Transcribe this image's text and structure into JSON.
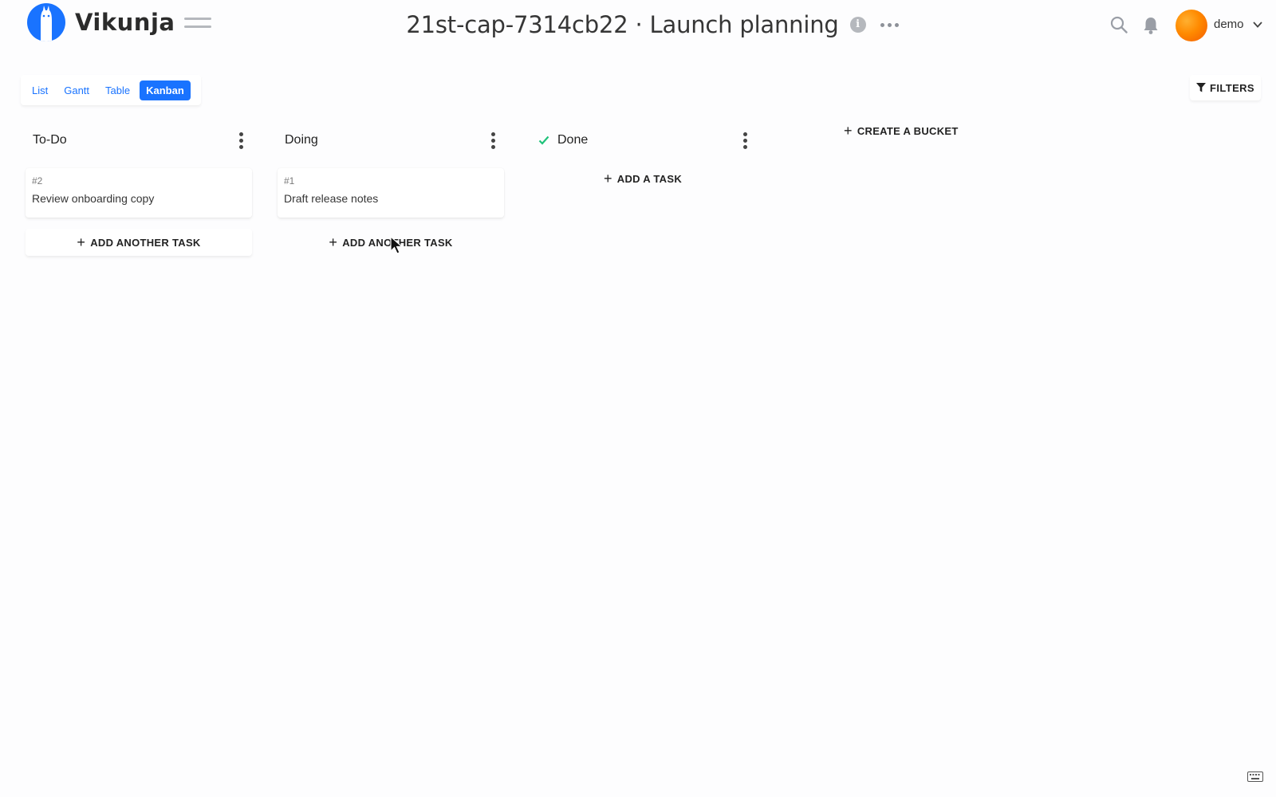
{
  "app": {
    "name": "Vikunja",
    "project_title": "21st-cap-7314cb22 · Launch planning",
    "accent_color": "#1973ff",
    "icons": [
      "vikunja-logo-icon",
      "menu-icon",
      "info-icon",
      "more-icon",
      "search-icon",
      "bell-icon",
      "chevron-down-icon",
      "filter-icon",
      "kebab-icon",
      "check-icon",
      "keyboard-icon"
    ]
  },
  "user": {
    "name": "demo"
  },
  "views": {
    "tabs": [
      {
        "label": "List"
      },
      {
        "label": "Gantt"
      },
      {
        "label": "Table"
      },
      {
        "label": "Kanban",
        "active": true
      }
    ],
    "filters_label": "FILTERS"
  },
  "buckets": [
    {
      "title": "To-Do",
      "cards": [
        {
          "id": "#2",
          "title": "Review onboarding copy"
        }
      ],
      "add_label": "ADD ANOTHER TASK"
    },
    {
      "title": "Doing",
      "cards": [
        {
          "id": "#1",
          "title": "Draft release notes"
        }
      ],
      "add_label": "ADD ANOTHER TASK"
    },
    {
      "title": "Done",
      "done": true,
      "cards": [],
      "add_label": "ADD A TASK"
    }
  ],
  "create_bucket_label": "CREATE A BUCKET"
}
